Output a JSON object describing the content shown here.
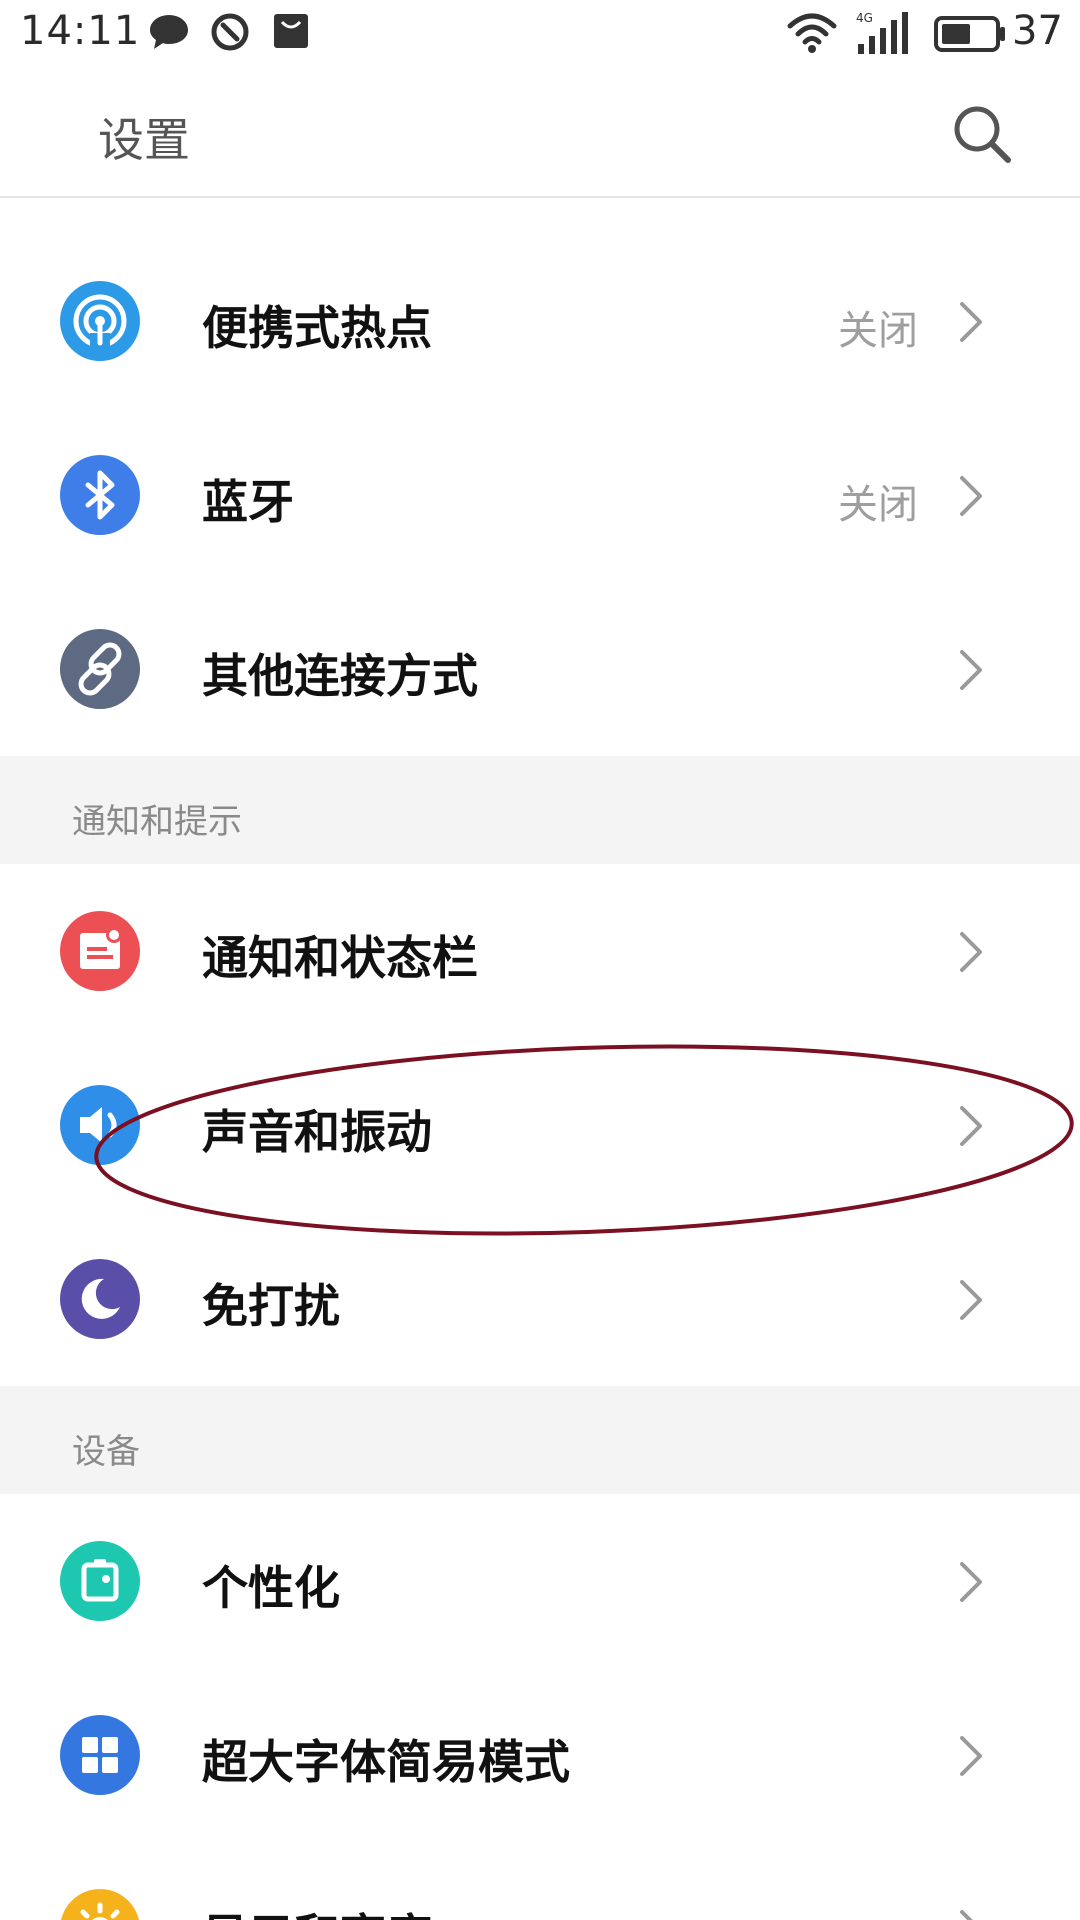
{
  "status_bar": {
    "time": "14:11",
    "network": "4G",
    "battery_level": "37",
    "icons": [
      "message-icon",
      "compass-icon",
      "shopping-bag-icon",
      "wifi-icon",
      "signal-icon",
      "battery-icon"
    ]
  },
  "header": {
    "title": "设置",
    "search_icon": "search-icon"
  },
  "rows": [
    {
      "label": "便携式热点",
      "value": "关闭",
      "icon": "hotspot-icon",
      "color": "#2d9ae8"
    },
    {
      "label": "蓝牙",
      "value": "关闭",
      "icon": "bluetooth-icon",
      "color": "#3f7ee8"
    },
    {
      "label": "其他连接方式",
      "value": "",
      "icon": "link-icon",
      "color": "#5d6a82"
    },
    {
      "label": "通知和状态栏",
      "value": "",
      "icon": "notification-icon",
      "color": "#ec5055"
    },
    {
      "label": "声音和振动",
      "value": "",
      "icon": "sound-icon",
      "color": "#2f8ee8"
    },
    {
      "label": "免打扰",
      "value": "",
      "icon": "moon-icon",
      "color": "#5a4fa8"
    },
    {
      "label": "个性化",
      "value": "",
      "icon": "personalization-icon",
      "color": "#1ec7b0"
    },
    {
      "label": "超大字体简易模式",
      "value": "",
      "icon": "grid-icon",
      "color": "#3577e0"
    },
    {
      "label": "显示和亮度",
      "value": "",
      "icon": "sun-icon",
      "color": "#f6b21b"
    }
  ],
  "sections": [
    {
      "title": "通知和提示"
    },
    {
      "title": "设备"
    }
  ],
  "annotation": {
    "color": "#7a1022"
  },
  "colors": {
    "divider": "#e6e6e6",
    "section_bg": "#f4f4f4",
    "secondary_text": "#9e9e9e"
  }
}
